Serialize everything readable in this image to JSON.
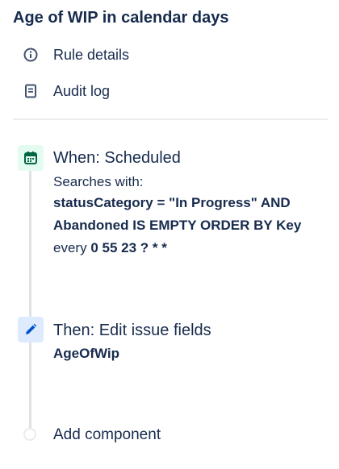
{
  "header": {
    "title": "Age of WIP in calendar days"
  },
  "menu": {
    "items": [
      {
        "label": "Rule details",
        "icon": "info-icon"
      },
      {
        "label": "Audit log",
        "icon": "document-icon"
      }
    ]
  },
  "trigger": {
    "heading": "When: Scheduled",
    "subheading": "Searches with:",
    "query_line1": "statusCategory = \"In Progress\" AND",
    "query_line2": "Abandoned IS EMPTY ORDER BY Key",
    "every_label": "every",
    "cron": "0 55 23 ? * *",
    "icon": "calendar-icon",
    "icon_color": "#006644",
    "icon_bg": "#e3fcef"
  },
  "action": {
    "heading": "Then: Edit issue fields",
    "field": "AgeOfWip",
    "icon": "pencil-icon",
    "icon_color": "#0052cc",
    "icon_bg": "#deebff"
  },
  "add_component": {
    "label": "Add component"
  }
}
